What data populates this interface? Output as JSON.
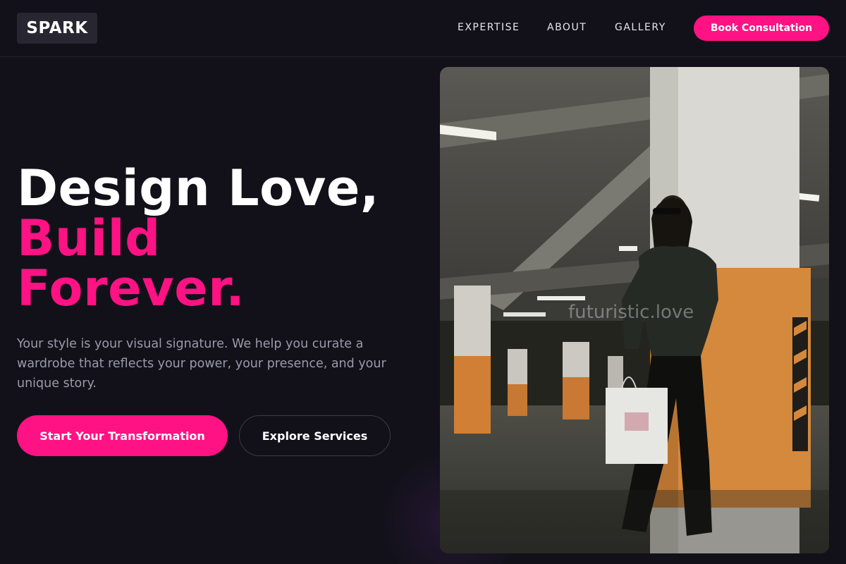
{
  "header": {
    "logo": "SPARK",
    "nav": [
      "EXPERTISE",
      "ABOUT",
      "GALLERY"
    ],
    "cta": "Book Consultation"
  },
  "hero": {
    "headline_line1": "Design Love,",
    "headline_line2": "Build",
    "headline_line3": "Forever.",
    "subtext": "Your style is your visual signature. We help you curate a wardrobe that reflects your power, your presence, and your unique story.",
    "primary_button": "Start Your Transformation",
    "secondary_button": "Explore Services",
    "image_watermark": "futuristic.love"
  },
  "colors": {
    "background": "#12111a",
    "accent": "#ff1283",
    "text_muted": "#9b9aa8"
  }
}
